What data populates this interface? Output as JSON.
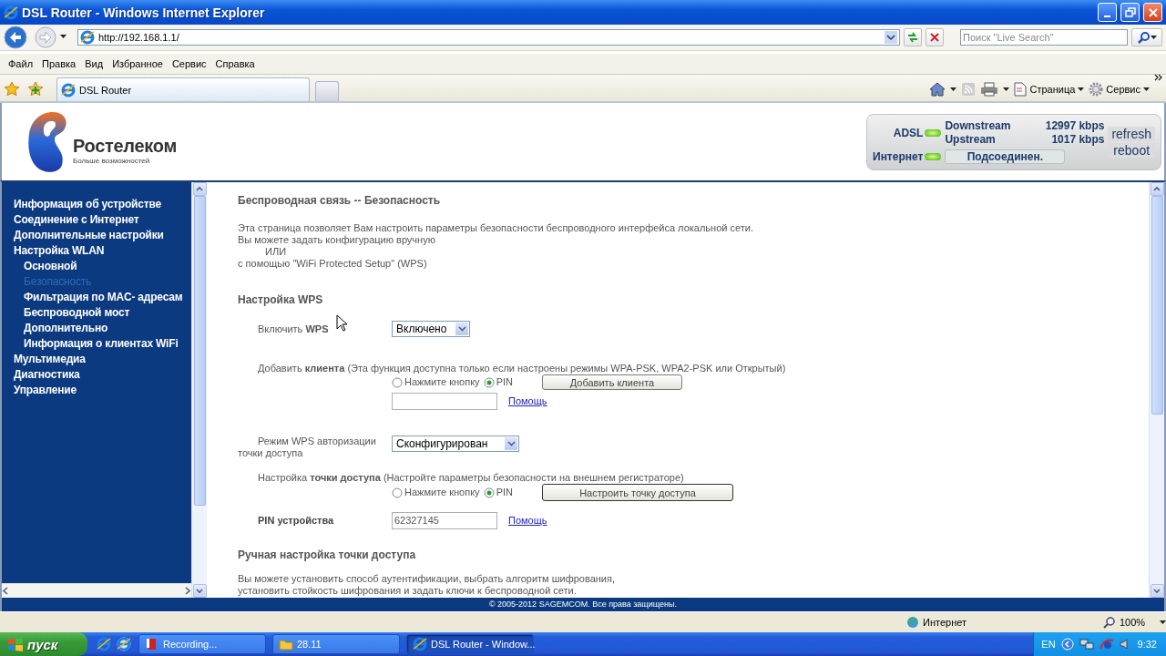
{
  "window": {
    "title": "DSL Router - Windows Internet Explorer"
  },
  "address_bar": {
    "url": "http://192.168.1.1/"
  },
  "search": {
    "placeholder": "Поиск \"Live Search\""
  },
  "menu": [
    "Файл",
    "Правка",
    "Вид",
    "Избранное",
    "Сервис",
    "Справка"
  ],
  "tabs": [
    {
      "label": "DSL Router",
      "selected": true
    }
  ],
  "command_bar": [
    "Страница",
    "Сервис"
  ],
  "router": {
    "brand": "Ростелеком",
    "slogan": "Больше возможностей",
    "status": {
      "adsl_label": "ADSL",
      "adsl_on": true,
      "downstream_label": "Downstream",
      "downstream": "12997 kbps",
      "upstream_label": "Upstream",
      "upstream": "1017 kbps",
      "internet_label": "Интернет",
      "internet_on": true,
      "internet_status": "Подсоединен.",
      "buttons": [
        "refresh",
        "reboot"
      ]
    }
  },
  "nav": [
    {
      "label": "Информация об устройстве",
      "selected": false
    },
    {
      "label": "Соединение с Интернет",
      "selected": false
    },
    {
      "label": "Дополнительные настройки",
      "selected": false
    },
    {
      "label": "Настройка WLAN",
      "selected": false,
      "children": [
        {
          "label": "Основной",
          "selected": false
        },
        {
          "label": "Безопасность",
          "selected": true
        },
        {
          "label": "Фильтрация по MAC- адресам",
          "selected": false
        },
        {
          "label": "Беспроводной мост",
          "selected": false
        },
        {
          "label": "Дополнительно",
          "selected": false
        },
        {
          "label": "Информация о клиентах WiFi",
          "selected": false
        }
      ]
    },
    {
      "label": "Мультимедиа",
      "selected": false
    },
    {
      "label": "Диагностика",
      "selected": false
    },
    {
      "label": "Управление",
      "selected": false
    }
  ],
  "page": {
    "title": "Беспроводная связь -- Безопасность",
    "intro": [
      "Эта страница позволяет Вам настроить параметры безопасности беспроводного интерфейса локальной сети.",
      "Вы можете задать конфигурацию вручную",
      "ИЛИ",
      "с помощью \"WiFi Protected Setup\" (WPS)"
    ],
    "wps_heading": "Настройка WPS",
    "enable_wps": {
      "label": "Включить **WPS**",
      "value": "Включено"
    },
    "add_client": {
      "label": "Добавить **клиента** (Эта функция доступна только если настроены режимы WPA-PSK, WPA2-PSK или Открытый)",
      "options": [
        {
          "label": "Нажмите кнопку",
          "selected": false
        },
        {
          "label": "PIN",
          "selected": true
        }
      ],
      "button": "Добавить клиента",
      "help": "Помощь"
    },
    "ap_mode": {
      "label": "Режим WPS авторизации точки доступа",
      "value": "Сконфигурирован"
    },
    "ap_setup": {
      "label": "Настройка **точки доступа** (Настройте параметры безопасности на внешнем регистраторе)",
      "options": [
        {
          "label": "Нажмите кнопку",
          "selected": false
        },
        {
          "label": "PIN",
          "selected": true
        }
      ],
      "button": "Настроить точку доступа"
    },
    "device_pin": {
      "label": "PIN устройства",
      "value": "62327145",
      "help": "Помощь"
    },
    "manual_heading": "Ручная настройка точки доступа",
    "manual_text": [
      "Вы можете установить способ аутентификации, выбрать алгоритм шифрования,",
      "установить стойкость шифрования и задать ключи к беспроводной сети."
    ]
  },
  "footer": "© 2005-2012 SAGEMCOM. Все права защищены.",
  "status_bar": {
    "zone": "Интернет",
    "zoom": "100%"
  },
  "taskbar": {
    "start": "пуск",
    "tasks": [
      {
        "label": "Recording...",
        "selected": false
      },
      {
        "label": "28.11",
        "selected": false
      },
      {
        "label": "DSL Router - Window...",
        "selected": true
      }
    ],
    "language": "EN",
    "clock": "9:32"
  }
}
